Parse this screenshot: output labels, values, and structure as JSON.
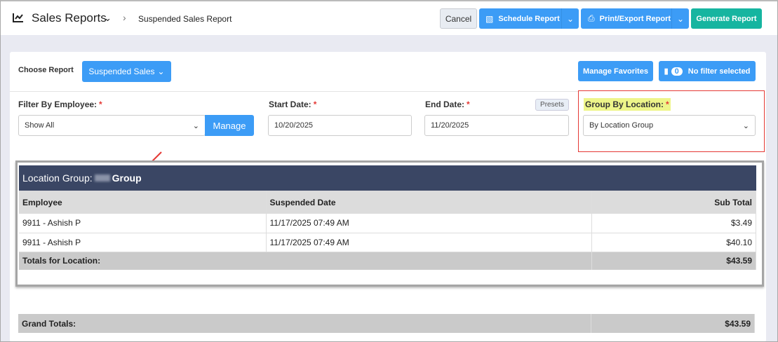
{
  "header": {
    "app_title": "Sales Reports",
    "breadcrumb_current": "Suspended Sales Report",
    "cancel": "Cancel",
    "schedule": "Schedule Report",
    "print_export": "Print/Export Report",
    "generate": "Generate Report"
  },
  "toolbar": {
    "choose_report_label": "Choose Report",
    "report_selected": "Suspended Sales",
    "manage_favorites": "Manage Favorites",
    "filter_count": "0",
    "filter_text": "No filter selected"
  },
  "filters": {
    "employee_label": "Filter By Employee:",
    "employee_value": "Show All",
    "manage": "Manage",
    "start_label": "Start Date:",
    "start_value": "10/20/2025",
    "end_label": "End Date:",
    "end_value": "11/20/2025",
    "presets": "Presets",
    "group_label": "Group By Location:",
    "group_value": "By Location Group",
    "required_mark": "*"
  },
  "report": {
    "group_prefix": "Location Group:",
    "group_name": "Group",
    "columns": [
      "Employee",
      "Suspended Date",
      "Sub Total"
    ],
    "rows": [
      [
        "9911 - Ashish P",
        "11/17/2025 07:49 AM",
        "$3.49"
      ],
      [
        "9911 - Ashish P",
        "11/17/2025 07:49 AM",
        "$40.10"
      ]
    ],
    "totals_label": "Totals for Location:",
    "totals_value": "$43.59",
    "grand_label": "Grand Totals:",
    "grand_value": "$43.59"
  },
  "colors": {
    "primary": "#3c9cf6",
    "success": "#16b5a0",
    "group_header": "#3a4664",
    "highlight": "#eef58a",
    "annotation": "#e53935"
  }
}
